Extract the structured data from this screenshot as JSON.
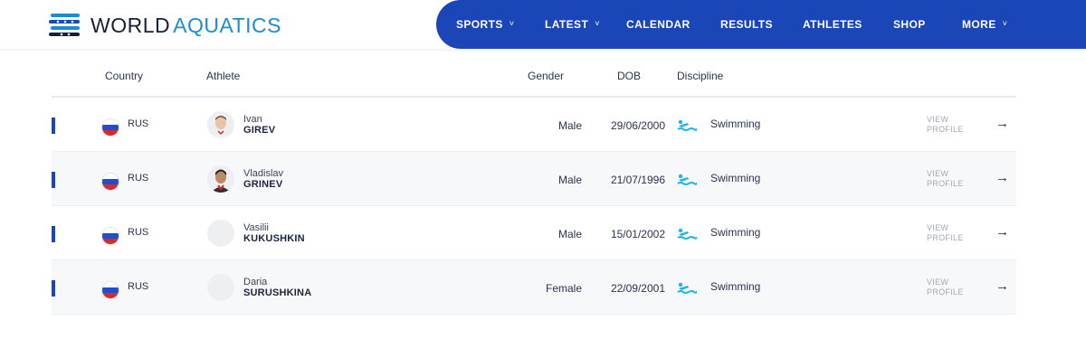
{
  "header": {
    "logo_word1": "WORLD",
    "logo_word2": "AQUATICS",
    "nav": [
      {
        "label": "SPORTS",
        "has_dropdown": true
      },
      {
        "label": "LATEST",
        "has_dropdown": true
      },
      {
        "label": "CALENDAR",
        "has_dropdown": false
      },
      {
        "label": "RESULTS",
        "has_dropdown": false
      },
      {
        "label": "ATHLETES",
        "has_dropdown": false
      },
      {
        "label": "SHOP",
        "has_dropdown": false
      },
      {
        "label": "MORE",
        "has_dropdown": true
      }
    ],
    "chevron": "˅"
  },
  "table": {
    "headers": {
      "country": "Country",
      "athlete": "Athlete",
      "gender": "Gender",
      "dob": "DOB",
      "discipline": "Discipline"
    },
    "view_line1": "VIEW",
    "view_line2": "PROFILE",
    "arrow": "→",
    "rows": [
      {
        "country": "RUS",
        "first": "Ivan",
        "last": "GIREV",
        "gender": "Male",
        "dob": "29/06/2000",
        "discipline": "Swimming",
        "has_photo": true
      },
      {
        "country": "RUS",
        "first": "Vladislav",
        "last": "GRINEV",
        "gender": "Male",
        "dob": "21/07/1996",
        "discipline": "Swimming",
        "has_photo": true
      },
      {
        "country": "RUS",
        "first": "Vasilii",
        "last": "KUKUSHKIN",
        "gender": "Male",
        "dob": "15/01/2002",
        "discipline": "Swimming",
        "has_photo": false
      },
      {
        "country": "RUS",
        "first": "Daria",
        "last": "SURUSHKINA",
        "gender": "Female",
        "dob": "22/09/2001",
        "discipline": "Swimming",
        "has_photo": false
      }
    ]
  },
  "colors": {
    "brand_blue": "#1a46b8",
    "aqua": "#1b8ccf",
    "swim_icon": "#1fb3e6"
  }
}
